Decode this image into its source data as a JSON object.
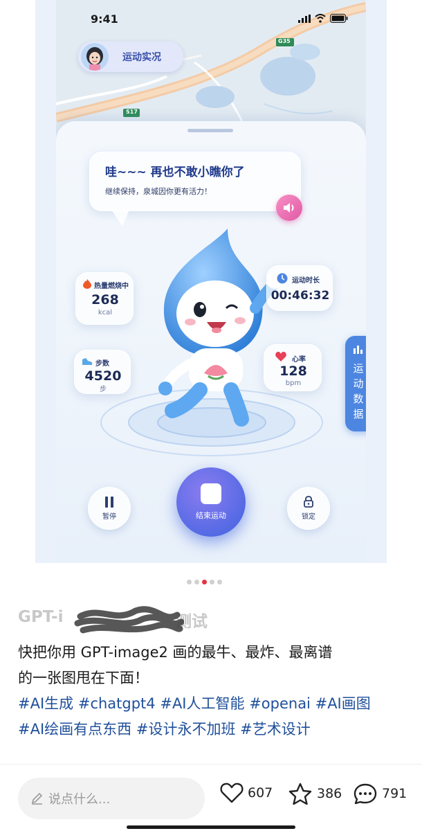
{
  "status_bar": {
    "time": "9:41"
  },
  "map": {
    "road_labels": [
      "G35",
      "S17"
    ]
  },
  "live_chip": {
    "label": "运动实况"
  },
  "speech": {
    "title": "哇~~~ 再也不敢小瞧你了",
    "subtitle": "继续保持，泉城因你更有活力！"
  },
  "stats": {
    "calories": {
      "title": "热量燃烧中",
      "value": "268",
      "unit": "kcal"
    },
    "duration": {
      "title": "运动时长",
      "value": "00:46:32"
    },
    "steps": {
      "title": "步数",
      "value": "4520",
      "unit": "步"
    },
    "heart": {
      "title": "心率",
      "value": "128",
      "unit": "bpm"
    }
  },
  "side_tab": {
    "label": "运动数据"
  },
  "controls": {
    "pause": "暂停",
    "end": "结束运动",
    "lock": "锁定"
  },
  "carousel": {
    "count": 5,
    "active_index": 3
  },
  "post": {
    "title_visible": "GPT-i",
    "title_tail": "测试",
    "body": "快把你用 GPT-image2 画的最牛、最炸、最离谱的一张图甩在下面！",
    "body_line1": "快把你用 GPT-image2 画的最牛、最炸、最离谱",
    "body_line2": "的一张图甩在下面！",
    "tags_line1": [
      "#AI生成",
      "#chatgpt4",
      "#AI人工智能",
      "#openai",
      "#AI画图"
    ],
    "tags_line2": [
      "#AI绘画有点东西",
      "#设计永不加班",
      "#艺术设计"
    ]
  },
  "bottom_bar": {
    "comment_placeholder": "说点什么...",
    "likes": "607",
    "favorites": "386",
    "comments": "791"
  },
  "colors": {
    "accent": "#1f4f9a",
    "active_dot": "#e8313f",
    "panel_blue": "#4d86e0"
  }
}
